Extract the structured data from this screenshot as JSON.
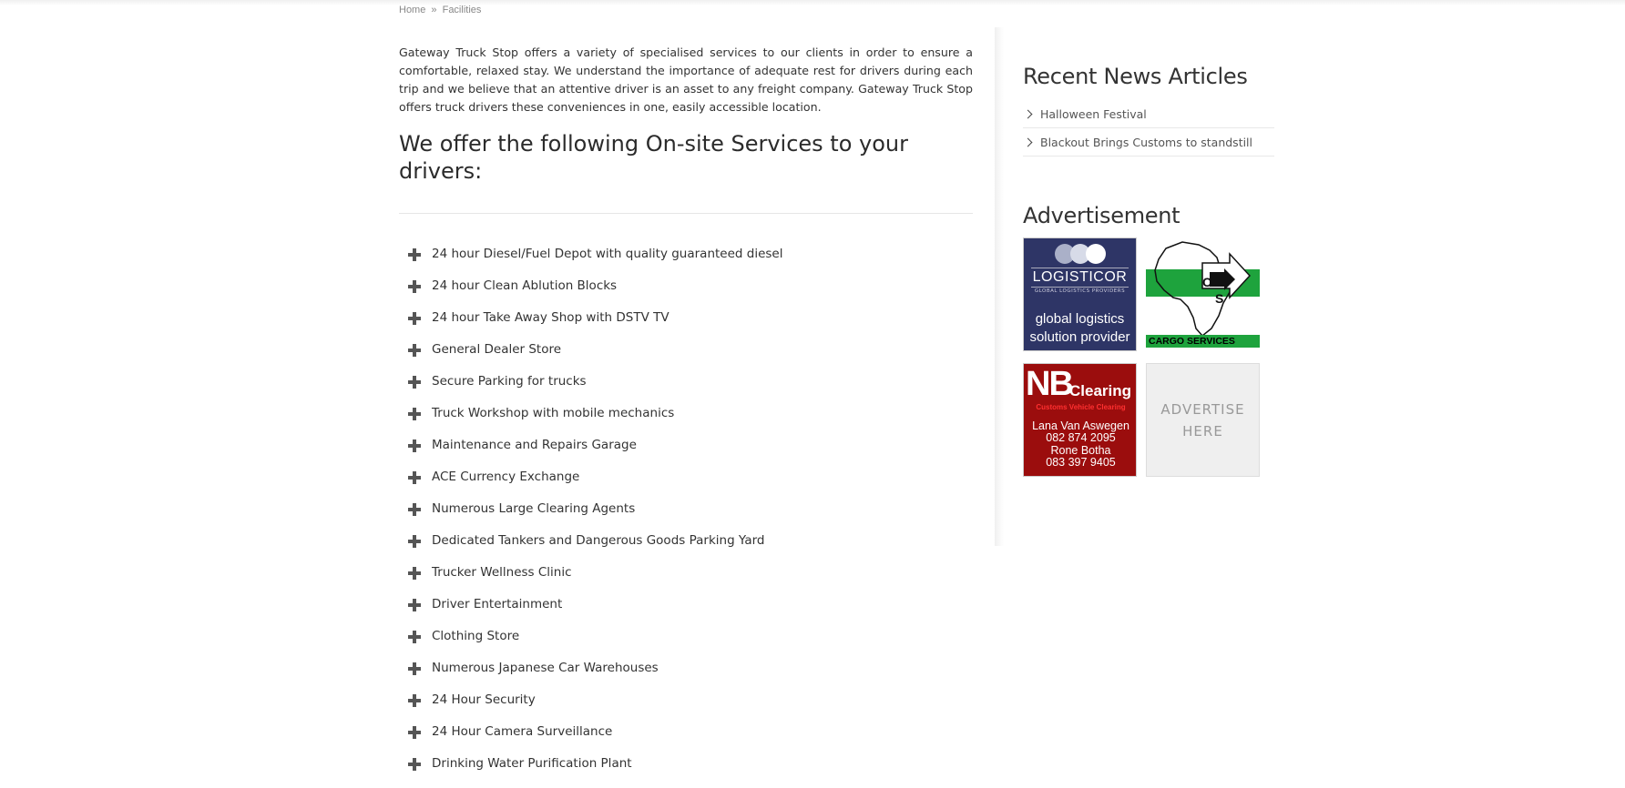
{
  "breadcrumb": {
    "home": "Home",
    "separator": "»",
    "current": "Facilities"
  },
  "main": {
    "intro": "Gateway Truck Stop offers a variety of specialised services to our clients in order to ensure a comfortable, relaxed stay. We understand the importance of adequate rest for drivers during each trip and we believe that an attentive driver is an asset to any freight company. Gateway Truck Stop offers truck drivers these conveniences in one, easily accessible location.",
    "heading": "We offer the following On-site Services to your drivers:",
    "services": [
      "24 hour Diesel/Fuel Depot with quality guaranteed diesel",
      "24 hour Clean Ablution Blocks",
      "24 hour Take Away Shop with DSTV TV",
      "General Dealer Store",
      "Secure Parking for trucks",
      "Truck Workshop with mobile mechanics",
      "Maintenance and Repairs Garage",
      "ACE Currency Exchange",
      "Numerous Large Clearing Agents",
      "Dedicated Tankers and Dangerous Goods Parking Yard",
      "Trucker Wellness Clinic",
      "Driver Entertainment",
      "Clothing Store",
      "Numerous Japanese Car Warehouses",
      "24 Hour Security",
      "24 Hour Camera Surveillance",
      "Drinking Water Purification Plant"
    ]
  },
  "sidebar": {
    "news_title": "Recent News Articles",
    "news": [
      "Halloween Festival",
      "Blackout Brings Customs to standstill"
    ],
    "ads_title": "Advertisement",
    "ads": {
      "logisticor": {
        "name": "LOGISTICOR",
        "sub": "GLOBAL LOGISTICS PROVIDERS",
        "line1": "global logistics",
        "line2": "solution provider"
      },
      "cargo": {
        "label": "CARGO SERVICES",
        "initials": "CS"
      },
      "nb": {
        "big": "NB",
        "clearing": "Clearing",
        "sub": "Customs Vehicle Clearing",
        "name1": "Lana Van Aswegen",
        "phone1": "082 874 2095",
        "name2": "Rone Botha",
        "phone2": "083 397 9405"
      },
      "advertise": {
        "line1": "ADVERTISE",
        "line2": "HERE"
      }
    }
  },
  "colors": {
    "text": "#333333",
    "logisticor_bg": "#2e3566",
    "cargo_green": "#1ea33d",
    "nb_red": "#9b0d0d"
  },
  "icons": {
    "service_bullet": "plus-icon",
    "news_bullet": "chevron-right-icon"
  }
}
